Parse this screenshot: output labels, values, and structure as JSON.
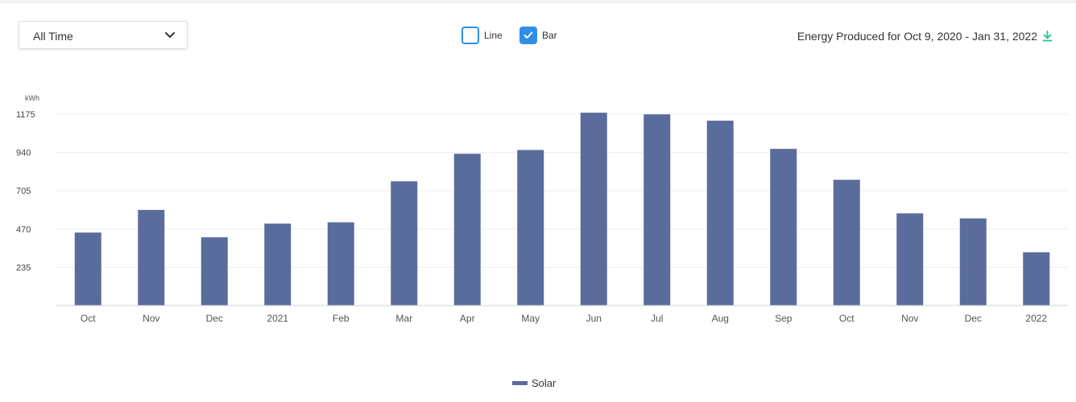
{
  "controls": {
    "range_label": "All Time",
    "line_label": "Line",
    "bar_label": "Bar",
    "line_checked": false,
    "bar_checked": true
  },
  "header": {
    "energy_title": "Energy Produced for Oct 9, 2020 - Jan 31, 2022"
  },
  "colors": {
    "bar": "#5a6c9b",
    "checkbox": "#2f8ee6",
    "download": "#2bbf8a"
  },
  "icons": [
    "chevron-down-icon",
    "checkmark-icon",
    "download-icon"
  ],
  "chart_data": {
    "type": "bar",
    "ylabel": "kWh",
    "categories": [
      "Oct",
      "Nov",
      "Dec",
      "2021",
      "Feb",
      "Mar",
      "Apr",
      "May",
      "Jun",
      "Jul",
      "Aug",
      "Sep",
      "Oct",
      "Nov",
      "Dec",
      "2022"
    ],
    "series": [
      {
        "name": "Solar",
        "values": [
          448,
          587,
          419,
          503,
          511,
          763,
          932,
          955,
          1184,
          1174,
          1135,
          962,
          772,
          566,
          535,
          327
        ]
      }
    ],
    "yticks": [
      235,
      470,
      705,
      940,
      1175
    ],
    "ylim": [
      0,
      1175
    ],
    "grid": true,
    "legend_position": "bottom-center"
  }
}
